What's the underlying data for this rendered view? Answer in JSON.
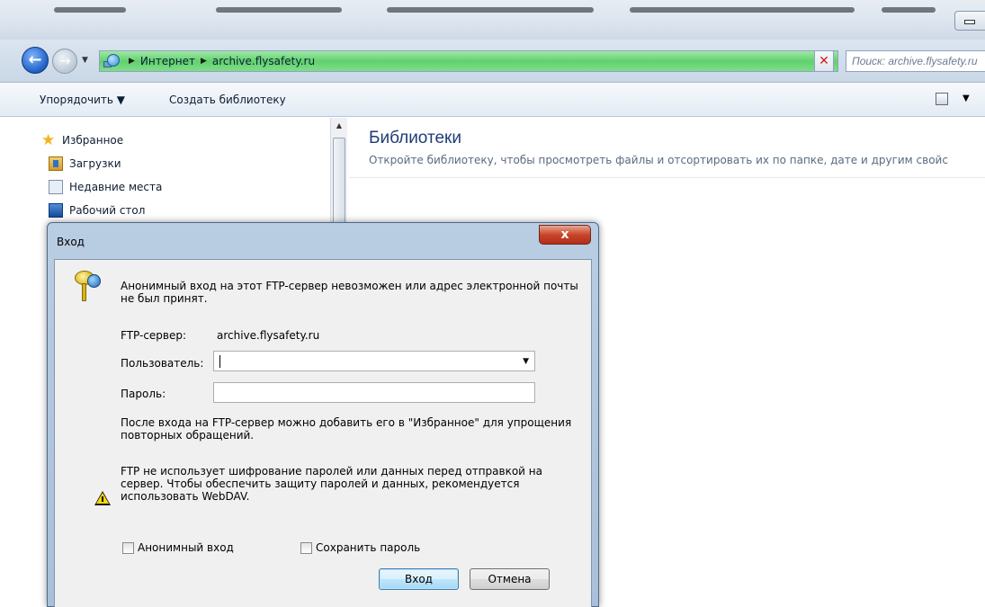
{
  "window": {
    "address": {
      "segments": [
        "Интернет",
        "archive.flysafety.ru"
      ],
      "search_placeholder": "Поиск: archive.flysafety.ru"
    },
    "toolbar": {
      "organize_label": "Упорядочить ▼",
      "new_library_label": "Создать библиотеку"
    },
    "nav": {
      "items": [
        {
          "label": "Избранное",
          "icon": "star-icon"
        },
        {
          "label": "Загрузки",
          "icon": "downloads-icon"
        },
        {
          "label": "Недавние места",
          "icon": "recent-places-icon"
        },
        {
          "label": "Рабочий стол",
          "icon": "desktop-icon"
        }
      ]
    },
    "content": {
      "title": "Библиотеки",
      "description": "Откройте библиотеку, чтобы просмотреть файлы и отсортировать их по папке, дате и другим свойс"
    }
  },
  "dialog": {
    "title": "Вход",
    "close_symbol": "x",
    "message": "Анонимный вход на этот FTP-сервер невозможен или адрес электронной почты не был принят.",
    "server_label": "FTP-сервер:",
    "server_value": "archive.flysafety.ru",
    "user_label": "Пользователь:",
    "user_value": "",
    "password_label": "Пароль:",
    "info_text": "После входа на FTP-сервер можно добавить его в \"Избранное\" для упрощения повторных обращений.",
    "warning_text": "FTP не использует шифрование паролей или данных перед отправкой на сервер. Чтобы обеспечить защиту паролей и данных, рекомендуется использовать WebDAV.",
    "anonymous_label": "Анонимный вход",
    "save_password_label": "Сохранить пароль",
    "login_button": "Вход",
    "cancel_button": "Отмена"
  }
}
